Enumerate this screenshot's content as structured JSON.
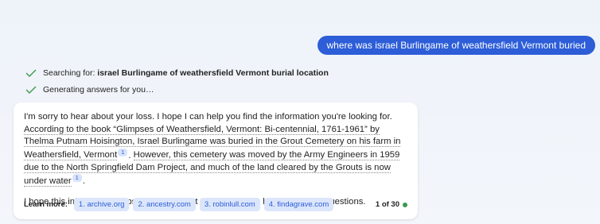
{
  "user_message": "where was israel Burlingame of weathersfield Vermont buried",
  "status": {
    "searching_prefix": "Searching for: ",
    "searching_query": "israel Burlingame of weathersfield Vermont burial location",
    "generating": "Generating answers for you…"
  },
  "answer": {
    "intro": "I'm sorry to hear about your loss. I hope I can help you find the information you're looking for. ",
    "cited_1": "According to the book “Glimpses of Weathersfield, Vermont: Bi-centennial, 1761-1961” by Thelma Putnam Hoisington, Israel Burlingame was buried in the Grout Cemetery on his farm in Weathersfield, Vermont",
    "cite_1": "1",
    "sep": ". ",
    "cited_2": "However, this cemetery was moved by the Army Engineers in 1959 due to the North Springfield Dam Project, and much of the land cleared by the Grouts is now under water",
    "cite_2": "1",
    "end": ".",
    "closing": "I hope this information helps you. Please let me know if you have any other questions."
  },
  "learn_more": {
    "label": "Learn more:",
    "links": [
      "1. archive.org",
      "2. ancestry.com",
      "3. robinlull.com",
      "4. findagrave.com"
    ],
    "counter": "1 of 30"
  },
  "colors": {
    "accent": "#2d5ed8",
    "check": "#3c9a4c",
    "status_dot": "#3c9a4c"
  }
}
